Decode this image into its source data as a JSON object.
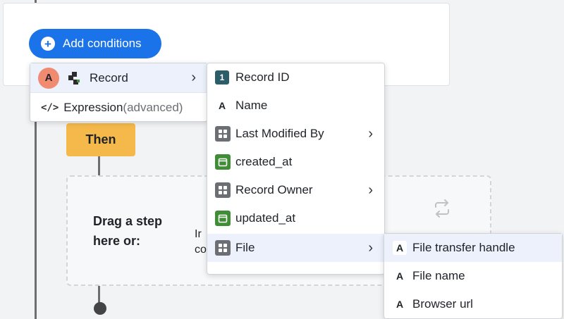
{
  "conditions": {
    "add_label": "Add conditions"
  },
  "source_menu": {
    "avatar_letter": "A",
    "record_label": "Record",
    "expression_label": "Expression",
    "expression_suffix": "(advanced)"
  },
  "record_fields": [
    {
      "label": "Record ID",
      "icon": "number-icon",
      "icon_text": "1"
    },
    {
      "label": "Name",
      "icon": "text-icon",
      "icon_text": "A"
    },
    {
      "label": "Last Modified By",
      "icon": "object-icon"
    },
    {
      "label": "created_at",
      "icon": "calendar-icon"
    },
    {
      "label": "Record Owner",
      "icon": "object-icon"
    },
    {
      "label": "updated_at",
      "icon": "calendar-icon"
    },
    {
      "label": "File",
      "icon": "object-icon"
    }
  ],
  "file_fields": [
    {
      "label": "File transfer handle",
      "icon_text": "A"
    },
    {
      "label": "File name",
      "icon_text": "A"
    },
    {
      "label": "Browser url",
      "icon_text": "A"
    }
  ],
  "then_block": {
    "label": "Then"
  },
  "dropzone": {
    "line1": "Drag a step",
    "line2": "here or:",
    "partial1": "Ir",
    "partial2": "co"
  },
  "colors": {
    "primary": "#1a73e8",
    "then": "#f4b94a",
    "avatar": "#f08a70",
    "calendar": "#3f8d35",
    "number": "#2e5d6a"
  }
}
